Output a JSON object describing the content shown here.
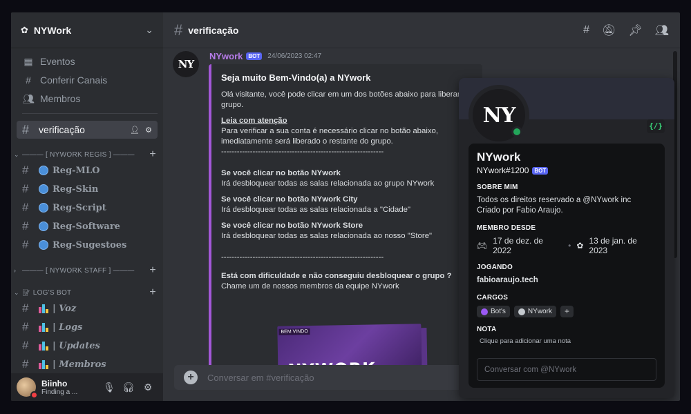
{
  "server": {
    "name": "NYWork"
  },
  "nav": [
    {
      "label": "Eventos",
      "icon": "calendar-icon"
    },
    {
      "label": "Conferir Canais",
      "icon": "browse-channels-icon"
    },
    {
      "label": "Membros",
      "icon": "members-icon"
    }
  ],
  "active_channel": {
    "name": "verificação"
  },
  "categories": [
    {
      "name": "——— [ NYWORK REGIS ] ———",
      "channels": [
        "Reg-MLO",
        "Reg-Skin",
        "Reg-Script",
        "Reg-Software",
        "Reg-Sugestoes"
      ]
    },
    {
      "name": "——— [ NYWORK STAFF ] ———",
      "channels": []
    },
    {
      "name": "LOG'S BOT",
      "channels": [
        "| Voz",
        "| Logs",
        "| Updates",
        "| Membros"
      ]
    }
  ],
  "user": {
    "name": "Biinho",
    "status": "Finding a ..."
  },
  "topbar": {
    "channel": "verificação"
  },
  "message": {
    "author": "NYwork",
    "badge": "BOT",
    "timestamp": "24/06/2023 02:47",
    "embed": {
      "title": "Seja muito Bem-Vindo(a) a NYwork",
      "intro": "Olá visitante, você pode clicar em um dos botões abaixo para liberar o grupo.",
      "attention_title": "Leia com atenção",
      "attention_text": "Para verificar a sua conta é necessário clicar no botão abaixo, imediatamente será liberado o restante do grupo.",
      "separator": "--------------------------------------------------------------",
      "opt1_title": "Se você clicar no botão NYwork",
      "opt1_text": "Irá desbloquear todas as salas relacionada ao grupo NYwork",
      "opt2_title": "Se você clicar no botão NYwork City",
      "opt2_text": "Irá desbloquear todas as salas relacionada a \"Cidade\"",
      "opt3_title": "Se você clicar no botão NYwork Store",
      "opt3_text": "Irá desbloquear todas as salas relacionada ao nosso \"Store\"",
      "help_title": "Está com dificuldade e não conseguiu desbloquear o grupo ?",
      "help_text": "Chame um de nossos membros da equipe NYwork",
      "banner_tag": "BEM VINDO",
      "banner_text": "NYWORK"
    }
  },
  "composer": {
    "placeholder": "Conversar em #verificação"
  },
  "profile": {
    "name": "NYwork",
    "tag": "NYwork#1200",
    "badge": "BOT",
    "dev_badge": "{/}",
    "about_title": "SOBRE MIM",
    "about_text_1": "Todos os direitos reservado a @NYwork inc",
    "about_text_2": "Criado por Fabio Araujo.",
    "member_since_title": "MEMBRO DESDE",
    "discord_date": "17 de dez. de 2022",
    "server_date": "13 de jan. de 2023",
    "playing_title": "JOGANDO",
    "playing": "fabioaraujo.tech",
    "roles_title": "CARGOS",
    "roles": [
      {
        "name": "Bot's",
        "color": "#9b59f5"
      },
      {
        "name": "NYwork",
        "color": "#c4c9ce"
      }
    ],
    "note_title": "NOTA",
    "note_placeholder": "Clique para adicionar uma nota",
    "dm_placeholder": "Conversar com @NYwork"
  }
}
